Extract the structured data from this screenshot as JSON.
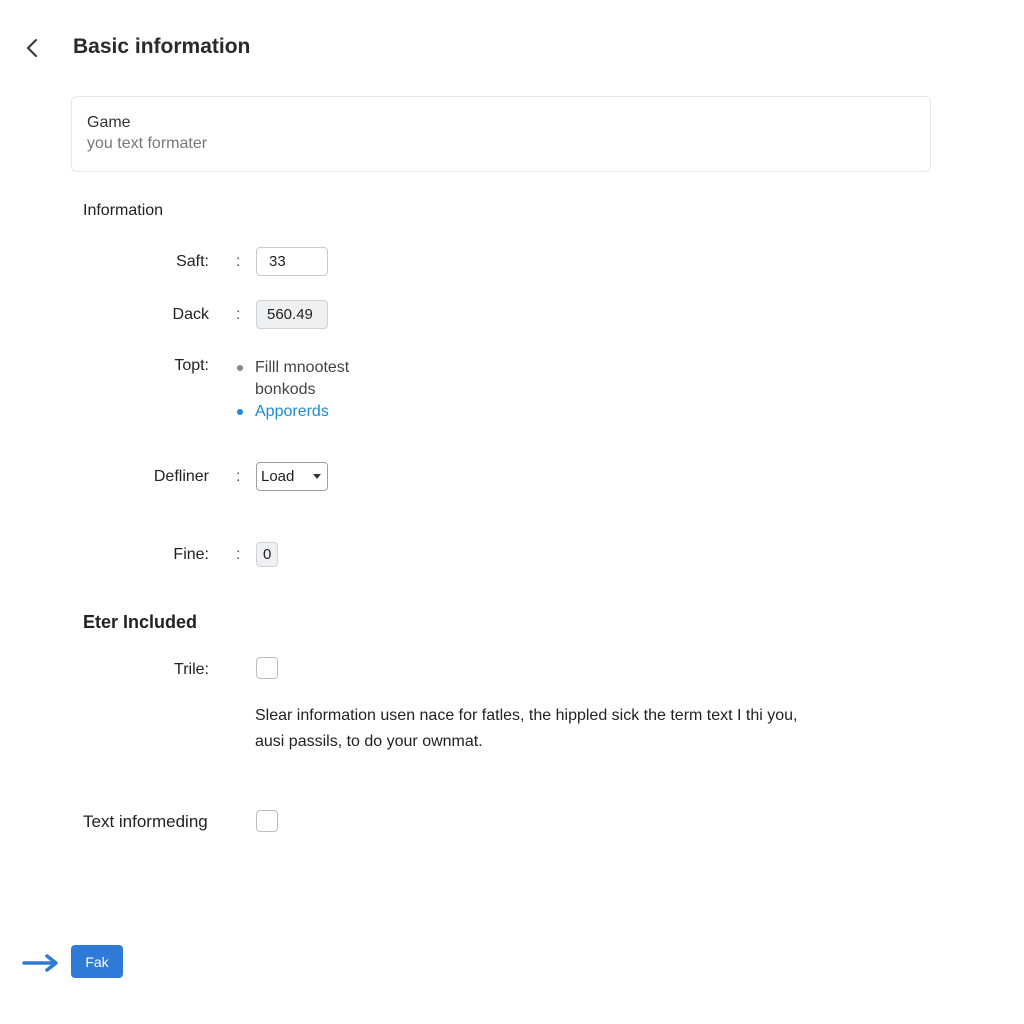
{
  "header": {
    "title": "Basic information",
    "back_icon": "chevron-left-icon"
  },
  "game_card": {
    "title": "Game",
    "subtitle": "you text formater"
  },
  "information": {
    "heading": "Information",
    "saft": {
      "label": "Saft:",
      "value": "33"
    },
    "dack": {
      "label": "Dack",
      "value": "560.49"
    },
    "topt": {
      "label": "Topt:",
      "items": [
        {
          "text": "Filll mnootest bonkods",
          "line1": "Filll mnootest",
          "line2": "bonkods",
          "color": "#888888"
        },
        {
          "text": "Apporerds",
          "color": "#1a8ccf"
        }
      ]
    },
    "definer": {
      "label": "Defliner",
      "selected": "Load"
    },
    "fine": {
      "label": "Fine:",
      "value": "0"
    },
    "separator": ":"
  },
  "eter_included": {
    "heading": "Eter Included",
    "trile": {
      "label": "Trile:",
      "checked": false
    },
    "help_text": "Slear information usen nace for fatles, the hippled sick the term text I thi you, ausi passils, to do your ownmat.",
    "help_line1": "Slear information usen nace for fatles, the hippled sick the term text I thi you,",
    "help_line2": "ausi passils, to do your ownmat."
  },
  "text_informeding": {
    "label": "Text informeding",
    "checked": false
  },
  "footer": {
    "button_label": "Fak",
    "arrow_icon": "arrow-right-icon",
    "accent_color": "#2f7ad6"
  }
}
